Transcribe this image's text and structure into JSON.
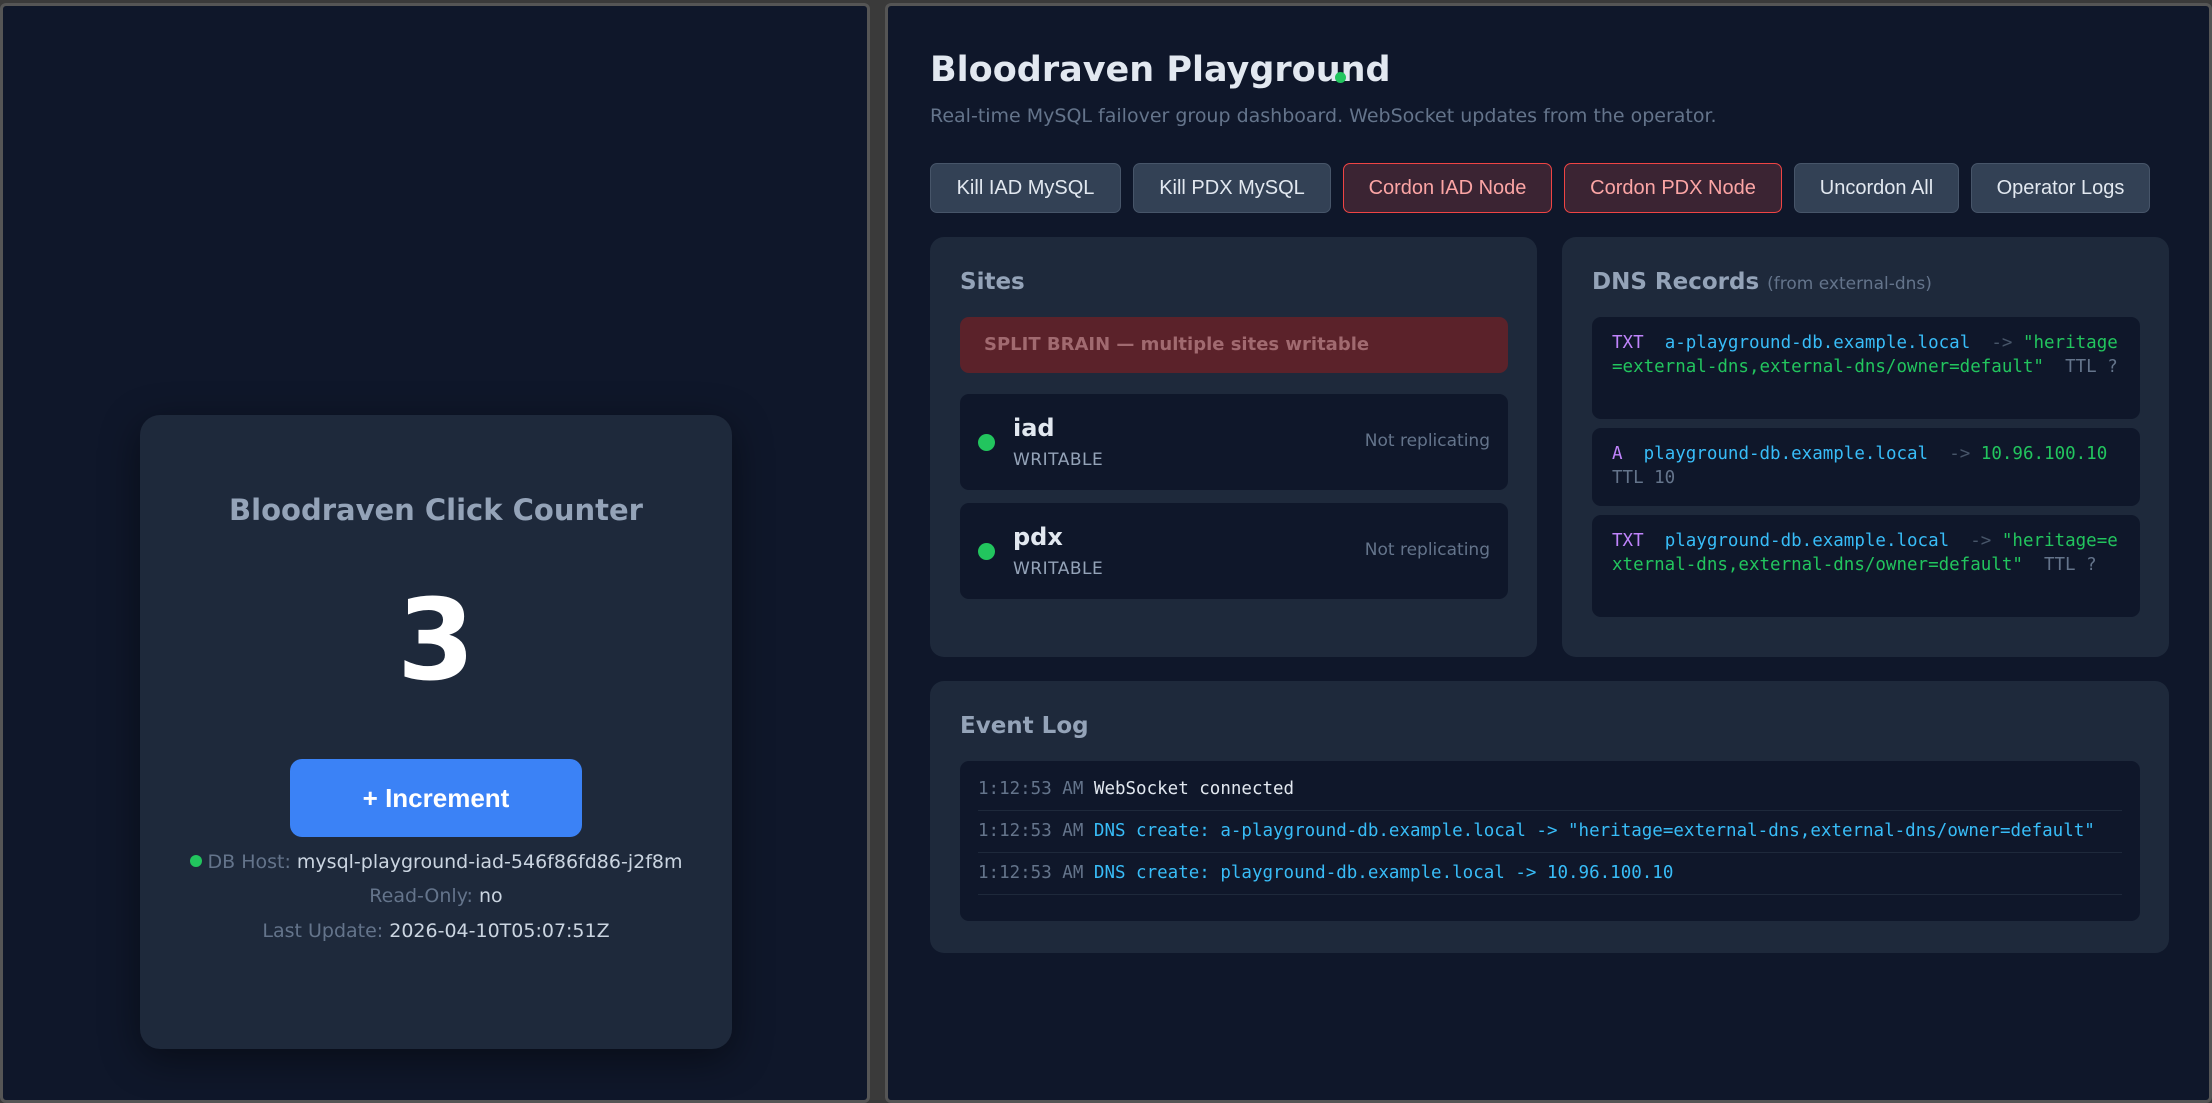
{
  "counter": {
    "title": "Bloodraven Click Counter",
    "value": "3",
    "increment_label": "+ Increment",
    "db_host_label": "DB Host:",
    "db_host": "mysql-playground-iad-546f86fd86-j2f8m",
    "readonly_label": "Read-Only:",
    "readonly": "no",
    "last_update_label": "Last Update:",
    "last_update": "2026-04-10T05:07:51Z"
  },
  "dashboard": {
    "title": "Bloodraven Playground",
    "subtitle": "Real-time MySQL failover group dashboard. WebSocket updates from the operator.",
    "buttons": [
      {
        "label": "Kill IAD MySQL",
        "variant": "neutral"
      },
      {
        "label": "Kill PDX MySQL",
        "variant": "neutral"
      },
      {
        "label": "Cordon IAD Node",
        "variant": "danger"
      },
      {
        "label": "Cordon PDX Node",
        "variant": "danger"
      },
      {
        "label": "Uncordon All",
        "variant": "neutral"
      },
      {
        "label": "Operator Logs",
        "variant": "neutral"
      }
    ]
  },
  "sites": {
    "title": "Sites",
    "alert": "SPLIT BRAIN — multiple sites writable",
    "items": [
      {
        "name": "iad",
        "state": "WRITABLE",
        "replication": "Not replicating"
      },
      {
        "name": "pdx",
        "state": "WRITABLE",
        "replication": "Not replicating"
      }
    ]
  },
  "dns": {
    "title": "DNS Records",
    "title_note": "(from external-dns)",
    "arrow": "->",
    "records": [
      {
        "type": "TXT",
        "name": "a-playground-db.example.local",
        "value": "\"heritage=external-dns,external-dns/owner=default\"",
        "ttl": "TTL ?"
      },
      {
        "type": "A",
        "name": "playground-db.example.local",
        "value": "10.96.100.10",
        "ttl": "TTL 10"
      },
      {
        "type": "TXT",
        "name": "playground-db.example.local",
        "value": "\"heritage=external-dns,external-dns/owner=default\"",
        "ttl": "TTL ?"
      }
    ]
  },
  "events": {
    "title": "Event Log",
    "entries": [
      {
        "time": "1:12:53 AM",
        "message": "WebSocket connected",
        "kind": "plain"
      },
      {
        "time": "1:12:53 AM",
        "message": "DNS create: a-playground-db.example.local -> \"heritage=external-dns,external-dns/owner=default\"",
        "kind": "dns"
      },
      {
        "time": "1:12:53 AM",
        "message": "DNS create: playground-db.example.local -> 10.96.100.10",
        "kind": "dns"
      }
    ]
  },
  "colors": {
    "background": "#0f172a",
    "panel": "#1e293b",
    "accent": "#3b82f6",
    "status_ok": "#22c55e",
    "danger": "#ef4444"
  }
}
